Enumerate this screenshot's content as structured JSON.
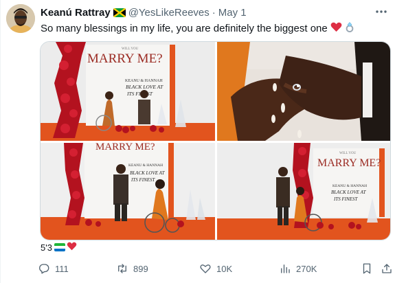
{
  "author": {
    "name": "Keanú Rattray",
    "handle": "@YesLikeReeves",
    "time": "May 1",
    "flag_icon": "jamaica-flag-icon"
  },
  "tweet": {
    "text": "So many blessings in my life,  you are definitely the biggest one",
    "emojis": [
      "red-heart-icon",
      "ring-icon"
    ]
  },
  "media": {
    "photo1": {
      "sign_small": "WILL YOU",
      "sign_big": "MARRY ME?",
      "sign_line1": "KEANU & HANNAH",
      "sign_line2": "BLACK LOVE AT",
      "sign_line3": "ITS FINEST"
    },
    "photo3": {
      "sign_big": "MARRY ME?",
      "sign_line1": "KEANU & HANNAH",
      "sign_line2": "BLACK LOVE AT",
      "sign_line3": "ITS FINEST"
    },
    "photo4": {
      "sign_small": "WILL YOU",
      "sign_big": "MARRY ME?",
      "sign_line1": "KEANU & HANNAH",
      "sign_line2": "BLACK LOVE AT",
      "sign_line3": "ITS FINEST"
    }
  },
  "alt_note": {
    "text": "5'3",
    "icons": [
      "sierra-leone-flag-icon",
      "red-heart-icon"
    ]
  },
  "actions": {
    "replies": "111",
    "retweets": "899",
    "likes": "10K",
    "views": "270K"
  },
  "colors": {
    "text": "#0f1419",
    "secondary": "#536471",
    "heart": "#f91880",
    "floor_orange": "#e2541e",
    "roses": "#b3121f"
  }
}
